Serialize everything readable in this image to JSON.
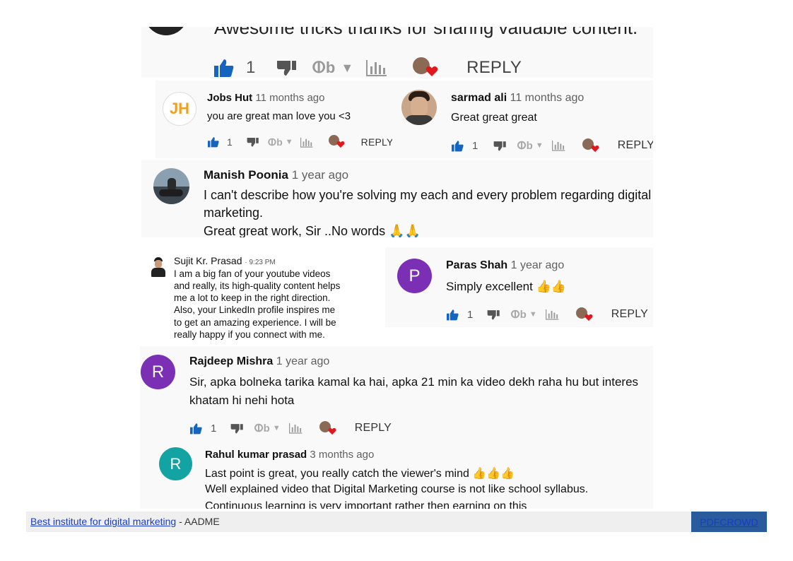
{
  "top_comment": {
    "text": "Awesome tricks thanks for sharing valuable content.",
    "likes": "1",
    "reply": "REPLY"
  },
  "jobs": {
    "name": "Jobs Hut",
    "time": "11 months ago",
    "text": "you are great man love you <3",
    "likes": "1",
    "reply": "REPLY",
    "avatar": "JH"
  },
  "sarmad": {
    "name": "sarmad ali",
    "time": "11 months ago",
    "text": "Great great great",
    "likes": "1",
    "reply": "REPLY"
  },
  "manish": {
    "name": "Manish Poonia",
    "time": "1 year ago",
    "line1": "I can't describe how you're solving my each and every problem regarding digital",
    "line2": "marketing.",
    "line3": "Great great work, Sir ..No words 🙏🙏"
  },
  "sujit": {
    "name": "Sujit Kr. Prasad",
    "time": "· 9:23 PM",
    "lines": [
      "I am a big fan of your youtube videos",
      "and really, its high-quality content helps",
      "me a lot to keep in the right direction.",
      "Also, your LinkedIn profile inspires me",
      "to get an amazing experience. I will be",
      "really happy if you connect with me."
    ]
  },
  "paras": {
    "name": "Paras Shah",
    "time": "1 year ago",
    "text": "Simply excellent 👍👍",
    "likes": "1",
    "reply": "REPLY",
    "avatar": "P",
    "color": "#7b2fb5"
  },
  "rajdeep": {
    "name": "Rajdeep Mishra",
    "time": "1 year ago",
    "line1": "Sir,  apka bolneka tarika kamal ka hai,  apka 21 min ka video dekh raha hu but interes",
    "line2": "khatam hi nehi hota",
    "likes": "1",
    "reply": "REPLY",
    "avatar": "R",
    "color": "#7b2fb5"
  },
  "rahul": {
    "name": "Rahul kumar prasad",
    "time": "3 months ago",
    "line1": "Last point is great, you really catch the viewer's mind 👍👍👍",
    "line2": "Well explained video that Digital Marketing course is not like school syllabus.",
    "line3": "Continuous learning is very important rather then earning on this",
    "avatar": "R",
    "color": "#14a3a3"
  },
  "footer": {
    "link": "Best institute for digital marketing",
    "suffix": " - AADME",
    "button": "PDFCROWD"
  },
  "colors": {
    "like_blue": "#1565c0",
    "heart_red": "#e0191e"
  },
  "icons": [
    "thumbs-up-icon",
    "thumbs-down-icon",
    "heart-icon",
    "stats-icon",
    "dislike-text-icon"
  ]
}
